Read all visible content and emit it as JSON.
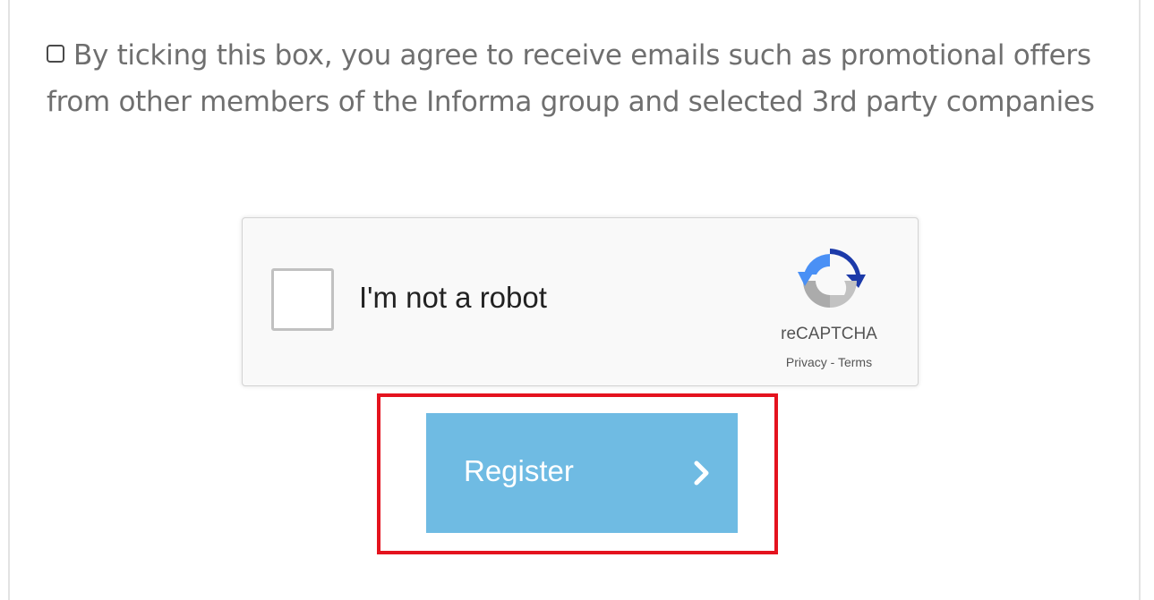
{
  "consent": {
    "checked": false,
    "text": "By ticking this box, you agree to receive emails such as promotional offers from other members of the Informa group and selected 3rd party companies"
  },
  "recaptcha": {
    "label": "I'm not a robot",
    "brand": "reCAPTCHA",
    "privacy_link": "Privacy",
    "separator": "-",
    "terms_link": "Terms",
    "checked": false
  },
  "register": {
    "label": "Register",
    "icon": "chevron-right-icon",
    "button_color": "#6fbbe3"
  },
  "highlight": {
    "color": "#e4131e"
  }
}
